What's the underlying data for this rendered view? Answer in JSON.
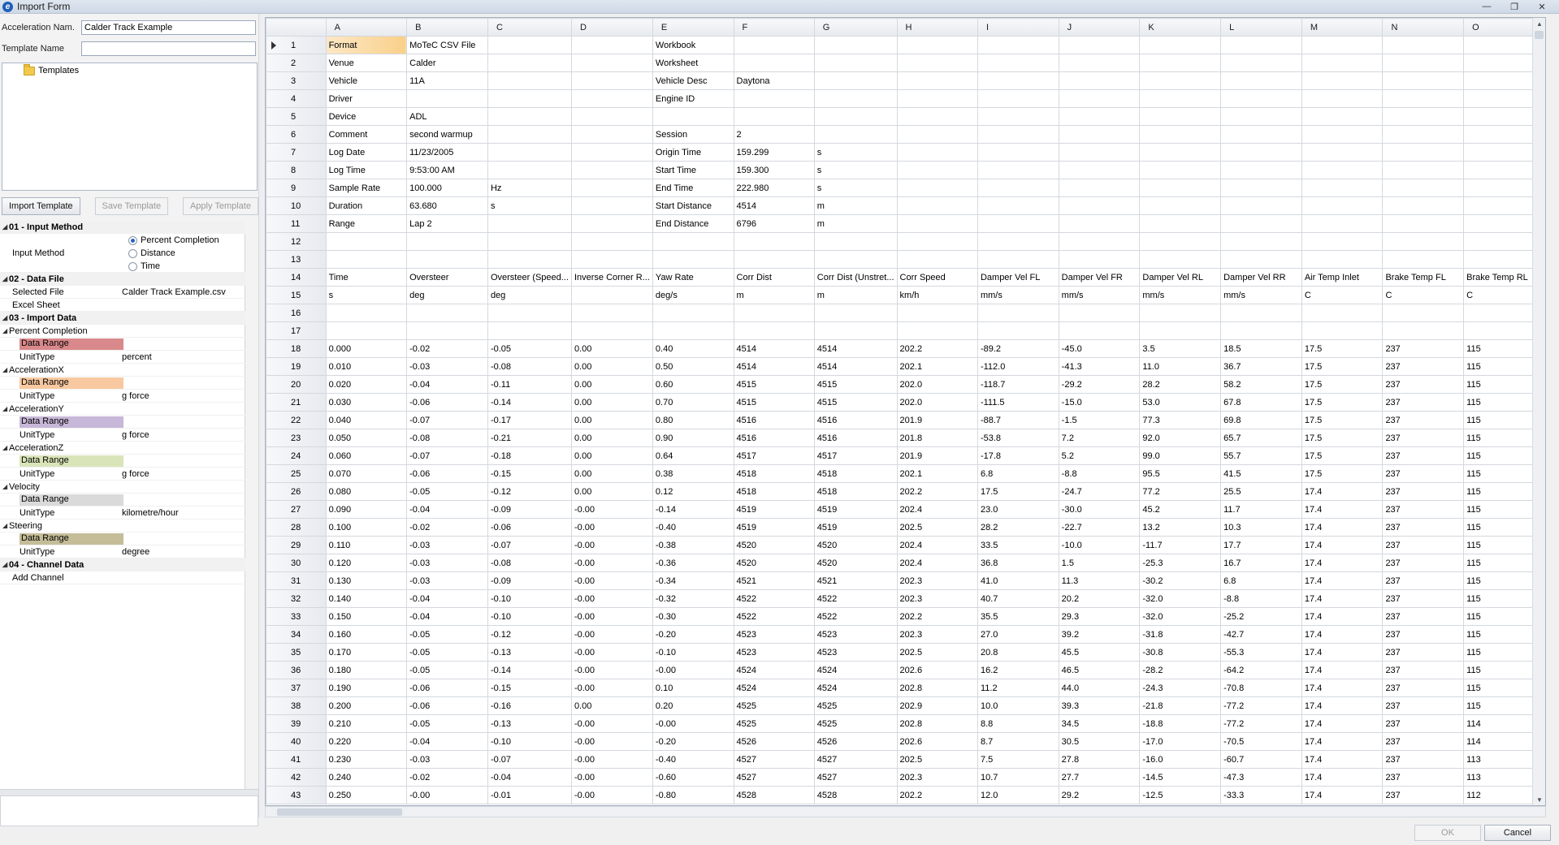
{
  "window": {
    "title": "Import Form",
    "icon": "app-logo-icon",
    "minimize": "—",
    "restore": "❐",
    "close": "✕"
  },
  "form": {
    "acceleration_label": "Acceleration Nam.",
    "acceleration_value": "Calder Track Example",
    "template_label": "Template Name",
    "template_value": ""
  },
  "templates_tree": {
    "root_label": "Templates"
  },
  "template_buttons": {
    "import": "Import Template",
    "save": "Save Template",
    "apply": "Apply Template"
  },
  "properties": {
    "input_method_cat": "01 - Input Method",
    "input_method_label": "Input Method",
    "input_options": [
      "Percent Completion",
      "Distance",
      "Time"
    ],
    "input_selected": "Percent Completion",
    "data_file_cat": "02 - Data File",
    "selected_file_label": "Selected File",
    "selected_file_value": "Calder Track Example.csv",
    "excel_sheet_label": "Excel Sheet",
    "import_data_cat": "03 - Import Data",
    "groups": [
      {
        "name": "Percent Completion",
        "range_label": "Data Range",
        "unit_label": "UnitType",
        "unit": "percent",
        "color": "#d9898b"
      },
      {
        "name": "AccelerationX",
        "range_label": "Data Range",
        "unit_label": "UnitType",
        "unit": "g force",
        "color": "#f8c9a0"
      },
      {
        "name": "AccelerationY",
        "range_label": "Data Range",
        "unit_label": "UnitType",
        "unit": "g force",
        "color": "#c7b7d8"
      },
      {
        "name": "AccelerationZ",
        "range_label": "Data Range",
        "unit_label": "UnitType",
        "unit": "g force",
        "color": "#d9e5b8"
      },
      {
        "name": "Velocity",
        "range_label": "Data Range",
        "unit_label": "UnitType",
        "unit": "kilometre/hour",
        "color": "#dadada"
      },
      {
        "name": "Steering",
        "range_label": "Data Range",
        "unit_label": "UnitType",
        "unit": "degree",
        "color": "#c4bd98"
      }
    ],
    "channel_data_cat": "04 - Channel Data",
    "add_channel_label": "Add Channel"
  },
  "sheet": {
    "columns": [
      "A",
      "B",
      "C",
      "D",
      "E",
      "F",
      "G",
      "H",
      "I",
      "J",
      "K",
      "L",
      "M",
      "N",
      "O"
    ],
    "active_row": 1,
    "active_col": 0,
    "rows": [
      [
        "Format",
        "MoTeC CSV File",
        "",
        "",
        "Workbook",
        "",
        "",
        "",
        "",
        "",
        "",
        "",
        "",
        "",
        ""
      ],
      [
        "Venue",
        "Calder",
        "",
        "",
        "Worksheet",
        "",
        "",
        "",
        "",
        "",
        "",
        "",
        "",
        "",
        ""
      ],
      [
        "Vehicle",
        "11A",
        "",
        "",
        "Vehicle Desc",
        "Daytona",
        "",
        "",
        "",
        "",
        "",
        "",
        "",
        "",
        ""
      ],
      [
        "Driver",
        "",
        "",
        "",
        "Engine ID",
        "",
        "",
        "",
        "",
        "",
        "",
        "",
        "",
        "",
        ""
      ],
      [
        "Device",
        "ADL",
        "",
        "",
        "",
        "",
        "",
        "",
        "",
        "",
        "",
        "",
        "",
        "",
        ""
      ],
      [
        "Comment",
        "second warmup",
        "",
        "",
        "Session",
        "2",
        "",
        "",
        "",
        "",
        "",
        "",
        "",
        "",
        ""
      ],
      [
        "Log Date",
        "11/23/2005",
        "",
        "",
        "Origin Time",
        "159.299",
        "s",
        "",
        "",
        "",
        "",
        "",
        "",
        "",
        ""
      ],
      [
        "Log Time",
        "9:53:00 AM",
        "",
        "",
        "Start Time",
        "159.300",
        "s",
        "",
        "",
        "",
        "",
        "",
        "",
        "",
        ""
      ],
      [
        "Sample Rate",
        "100.000",
        "Hz",
        "",
        "End Time",
        "222.980",
        "s",
        "",
        "",
        "",
        "",
        "",
        "",
        "",
        ""
      ],
      [
        "Duration",
        "63.680",
        "s",
        "",
        "Start Distance",
        "4514",
        "m",
        "",
        "",
        "",
        "",
        "",
        "",
        "",
        ""
      ],
      [
        "Range",
        "Lap 2",
        "",
        "",
        "End Distance",
        "6796",
        "m",
        "",
        "",
        "",
        "",
        "",
        "",
        "",
        ""
      ],
      [
        "",
        "",
        "",
        "",
        "",
        "",
        "",
        "",
        "",
        "",
        "",
        "",
        "",
        "",
        ""
      ],
      [
        "",
        "",
        "",
        "",
        "",
        "",
        "",
        "",
        "",
        "",
        "",
        "",
        "",
        "",
        ""
      ],
      [
        "Time",
        "Oversteer",
        "Oversteer (Speed...",
        "Inverse Corner R...",
        "Yaw Rate",
        "Corr Dist",
        "Corr Dist (Unstret...",
        "Corr Speed",
        "Damper Vel FL",
        "Damper Vel FR",
        "Damper Vel RL",
        "Damper Vel RR",
        "Air Temp Inlet",
        "Brake Temp FL",
        "Brake Temp RL"
      ],
      [
        "s",
        "deg",
        "deg",
        "",
        "deg/s",
        "m",
        "m",
        "km/h",
        "mm/s",
        "mm/s",
        "mm/s",
        "mm/s",
        "C",
        "C",
        "C"
      ],
      [
        "",
        "",
        "",
        "",
        "",
        "",
        "",
        "",
        "",
        "",
        "",
        "",
        "",
        "",
        ""
      ],
      [
        "",
        "",
        "",
        "",
        "",
        "",
        "",
        "",
        "",
        "",
        "",
        "",
        "",
        "",
        ""
      ],
      [
        "0.000",
        "-0.02",
        "-0.05",
        "0.00",
        "0.40",
        "4514",
        "4514",
        "202.2",
        "-89.2",
        "-45.0",
        "3.5",
        "18.5",
        "17.5",
        "237",
        "115"
      ],
      [
        "0.010",
        "-0.03",
        "-0.08",
        "0.00",
        "0.50",
        "4514",
        "4514",
        "202.1",
        "-112.0",
        "-41.3",
        "11.0",
        "36.7",
        "17.5",
        "237",
        "115"
      ],
      [
        "0.020",
        "-0.04",
        "-0.11",
        "0.00",
        "0.60",
        "4515",
        "4515",
        "202.0",
        "-118.7",
        "-29.2",
        "28.2",
        "58.2",
        "17.5",
        "237",
        "115"
      ],
      [
        "0.030",
        "-0.06",
        "-0.14",
        "0.00",
        "0.70",
        "4515",
        "4515",
        "202.0",
        "-111.5",
        "-15.0",
        "53.0",
        "67.8",
        "17.5",
        "237",
        "115"
      ],
      [
        "0.040",
        "-0.07",
        "-0.17",
        "0.00",
        "0.80",
        "4516",
        "4516",
        "201.9",
        "-88.7",
        "-1.5",
        "77.3",
        "69.8",
        "17.5",
        "237",
        "115"
      ],
      [
        "0.050",
        "-0.08",
        "-0.21",
        "0.00",
        "0.90",
        "4516",
        "4516",
        "201.8",
        "-53.8",
        "7.2",
        "92.0",
        "65.7",
        "17.5",
        "237",
        "115"
      ],
      [
        "0.060",
        "-0.07",
        "-0.18",
        "0.00",
        "0.64",
        "4517",
        "4517",
        "201.9",
        "-17.8",
        "5.2",
        "99.0",
        "55.7",
        "17.5",
        "237",
        "115"
      ],
      [
        "0.070",
        "-0.06",
        "-0.15",
        "0.00",
        "0.38",
        "4518",
        "4518",
        "202.1",
        "6.8",
        "-8.8",
        "95.5",
        "41.5",
        "17.5",
        "237",
        "115"
      ],
      [
        "0.080",
        "-0.05",
        "-0.12",
        "0.00",
        "0.12",
        "4518",
        "4518",
        "202.2",
        "17.5",
        "-24.7",
        "77.2",
        "25.5",
        "17.4",
        "237",
        "115"
      ],
      [
        "0.090",
        "-0.04",
        "-0.09",
        "-0.00",
        "-0.14",
        "4519",
        "4519",
        "202.4",
        "23.0",
        "-30.0",
        "45.2",
        "11.7",
        "17.4",
        "237",
        "115"
      ],
      [
        "0.100",
        "-0.02",
        "-0.06",
        "-0.00",
        "-0.40",
        "4519",
        "4519",
        "202.5",
        "28.2",
        "-22.7",
        "13.2",
        "10.3",
        "17.4",
        "237",
        "115"
      ],
      [
        "0.110",
        "-0.03",
        "-0.07",
        "-0.00",
        "-0.38",
        "4520",
        "4520",
        "202.4",
        "33.5",
        "-10.0",
        "-11.7",
        "17.7",
        "17.4",
        "237",
        "115"
      ],
      [
        "0.120",
        "-0.03",
        "-0.08",
        "-0.00",
        "-0.36",
        "4520",
        "4520",
        "202.4",
        "36.8",
        "1.5",
        "-25.3",
        "16.7",
        "17.4",
        "237",
        "115"
      ],
      [
        "0.130",
        "-0.03",
        "-0.09",
        "-0.00",
        "-0.34",
        "4521",
        "4521",
        "202.3",
        "41.0",
        "11.3",
        "-30.2",
        "6.8",
        "17.4",
        "237",
        "115"
      ],
      [
        "0.140",
        "-0.04",
        "-0.10",
        "-0.00",
        "-0.32",
        "4522",
        "4522",
        "202.3",
        "40.7",
        "20.2",
        "-32.0",
        "-8.8",
        "17.4",
        "237",
        "115"
      ],
      [
        "0.150",
        "-0.04",
        "-0.10",
        "-0.00",
        "-0.30",
        "4522",
        "4522",
        "202.2",
        "35.5",
        "29.3",
        "-32.0",
        "-25.2",
        "17.4",
        "237",
        "115"
      ],
      [
        "0.160",
        "-0.05",
        "-0.12",
        "-0.00",
        "-0.20",
        "4523",
        "4523",
        "202.3",
        "27.0",
        "39.2",
        "-31.8",
        "-42.7",
        "17.4",
        "237",
        "115"
      ],
      [
        "0.170",
        "-0.05",
        "-0.13",
        "-0.00",
        "-0.10",
        "4523",
        "4523",
        "202.5",
        "20.8",
        "45.5",
        "-30.8",
        "-55.3",
        "17.4",
        "237",
        "115"
      ],
      [
        "0.180",
        "-0.05",
        "-0.14",
        "-0.00",
        "-0.00",
        "4524",
        "4524",
        "202.6",
        "16.2",
        "46.5",
        "-28.2",
        "-64.2",
        "17.4",
        "237",
        "115"
      ],
      [
        "0.190",
        "-0.06",
        "-0.15",
        "-0.00",
        "0.10",
        "4524",
        "4524",
        "202.8",
        "11.2",
        "44.0",
        "-24.3",
        "-70.8",
        "17.4",
        "237",
        "115"
      ],
      [
        "0.200",
        "-0.06",
        "-0.16",
        "0.00",
        "0.20",
        "4525",
        "4525",
        "202.9",
        "10.0",
        "39.3",
        "-21.8",
        "-77.2",
        "17.4",
        "237",
        "115"
      ],
      [
        "0.210",
        "-0.05",
        "-0.13",
        "-0.00",
        "-0.00",
        "4525",
        "4525",
        "202.8",
        "8.8",
        "34.5",
        "-18.8",
        "-77.2",
        "17.4",
        "237",
        "114"
      ],
      [
        "0.220",
        "-0.04",
        "-0.10",
        "-0.00",
        "-0.20",
        "4526",
        "4526",
        "202.6",
        "8.7",
        "30.5",
        "-17.0",
        "-70.5",
        "17.4",
        "237",
        "114"
      ],
      [
        "0.230",
        "-0.03",
        "-0.07",
        "-0.00",
        "-0.40",
        "4527",
        "4527",
        "202.5",
        "7.5",
        "27.8",
        "-16.0",
        "-60.7",
        "17.4",
        "237",
        "113"
      ],
      [
        "0.240",
        "-0.02",
        "-0.04",
        "-0.00",
        "-0.60",
        "4527",
        "4527",
        "202.3",
        "10.7",
        "27.7",
        "-14.5",
        "-47.3",
        "17.4",
        "237",
        "113"
      ],
      [
        "0.250",
        "-0.00",
        "-0.01",
        "-0.00",
        "-0.80",
        "4528",
        "4528",
        "202.2",
        "12.0",
        "29.2",
        "-12.5",
        "-33.3",
        "17.4",
        "237",
        "112"
      ]
    ]
  },
  "dialog_buttons": {
    "ok": "OK",
    "cancel": "Cancel"
  }
}
